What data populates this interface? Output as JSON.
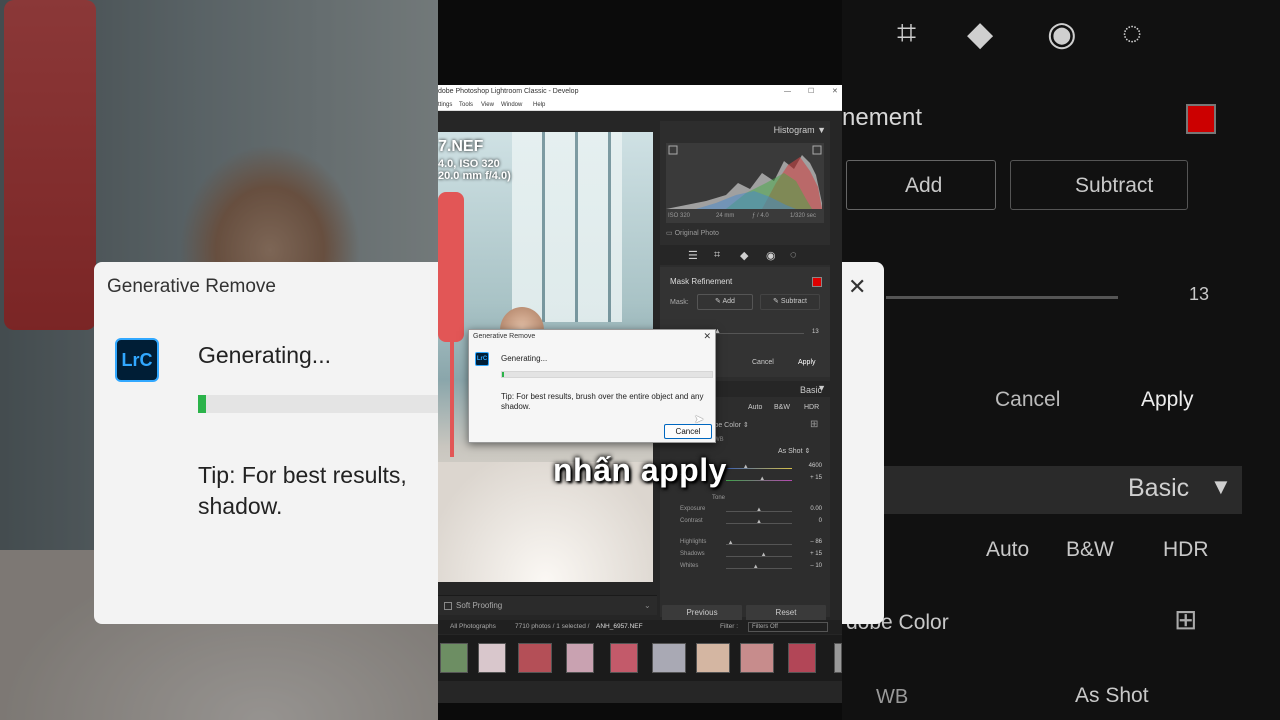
{
  "window": {
    "title": "dobe Photoshop Lightroom Classic - Develop",
    "menu": [
      "ttings",
      "Tools",
      "View",
      "Window",
      "Help"
    ],
    "controls": [
      "—",
      "☐",
      "✕"
    ]
  },
  "photo_meta": {
    "filename": "7.NEF",
    "line2": "4.0, ISO 320",
    "line3": "20.0 mm f/4.0)"
  },
  "histogram": {
    "title": "Histogram",
    "iso": "ISO 320",
    "focal": "24 mm",
    "aperture": "ƒ / 4.0",
    "shutter": "1/320 sec",
    "original_photo": "Original Photo"
  },
  "mask_refinement": {
    "title": "Mask Refinement",
    "mask_label": "Mask:",
    "add": "Add",
    "subtract": "Subtract",
    "value": "13",
    "cancel": "Cancel",
    "apply": "Apply"
  },
  "basic": {
    "title": "Basic",
    "auto": "Auto",
    "bw": "B&W",
    "hdr": "HDR",
    "profile": "Adobe Color",
    "wb_label": "WB",
    "wb_value": "As Shot",
    "tone_label": "Tone",
    "sliders": [
      {
        "label": "",
        "value": "4600",
        "pos": 0.3
      },
      {
        "label": "Tint",
        "value": "+ 15",
        "pos": 0.55
      },
      {
        "label": "Exposure",
        "value": "0.00",
        "pos": 0.5
      },
      {
        "label": "Contrast",
        "value": "0",
        "pos": 0.5
      },
      {
        "label": "Highlights",
        "value": "– 86",
        "pos": 0.07
      },
      {
        "label": "Shadows",
        "value": "+ 15",
        "pos": 0.57
      },
      {
        "label": "Whites",
        "value": "– 10",
        "pos": 0.45
      }
    ],
    "previous": "Previous",
    "reset": "Reset"
  },
  "soft_proofing": "Soft Proofing",
  "filter_bar": {
    "source": "All Photographs",
    "count": "7710 photos / 1 selected /",
    "selected": "ANH_6957.NEF",
    "filter_label": "Filter :",
    "filter_value": "Filters Off"
  },
  "dialog": {
    "title": "Generative Remove",
    "logo": "LrC",
    "status": "Generating...",
    "progress": 0.01,
    "tip": "Tip: For best results, brush over the entire object and any shadow.",
    "cancel": "Cancel"
  },
  "caption": "nhấn apply",
  "zoom_left": {
    "title": "Generative Remove",
    "logo": "LrC",
    "status": "Generating...",
    "tip_line1": "Tip: For best results,",
    "tip_line2": "shadow."
  },
  "zoom_right": {
    "title": "nement",
    "add": "Add",
    "subtract": "Subtract",
    "value": "13",
    "cancel": "Cancel",
    "apply": "Apply",
    "basic": "Basic",
    "auto": "Auto",
    "bw": "B&W",
    "hdr": "HDR",
    "profile": "dobe Color",
    "wb": "WB",
    "asshot": "As Shot",
    "tail": "y"
  },
  "colors": {
    "accent_green": "#2bb34a",
    "mask_red": "#dd0000",
    "lrc_blue": "#31a8ff"
  }
}
